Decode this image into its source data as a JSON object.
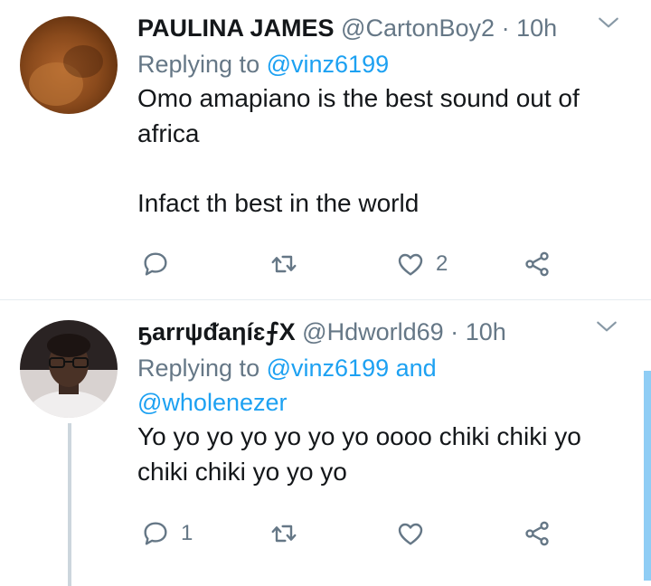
{
  "tweets": [
    {
      "name": "PAULINA JAMES",
      "handle": "@CartonBoy2",
      "separator": "·",
      "time": "10h",
      "replying_prefix": "Replying to",
      "replying_to": [
        "@vinz6199"
      ],
      "replying_joiner": "",
      "text_lines": [
        "Omo amapiano is the best sound out of",
        "africa",
        "",
        "Infact th best in the world"
      ],
      "reply_count": "",
      "retweet_count": "",
      "like_count": "2"
    },
    {
      "name": "ҕarrψᵭaηíɛ⨍X",
      "handle": "@Hdworld69",
      "separator": "·",
      "time": "10h",
      "replying_prefix": "Replying to",
      "replying_to": [
        "@vinz6199",
        "@wholenezer"
      ],
      "replying_joiner": "and",
      "text_lines": [
        "Yo yo yo yo yo yo yo oooo chiki chiki yo",
        "chiki chiki yo yo yo"
      ],
      "reply_count": "1",
      "retweet_count": "",
      "like_count": ""
    }
  ],
  "icons": {
    "reply": "reply-icon",
    "retweet": "retweet-icon",
    "like": "heart-icon",
    "share": "share-icon",
    "more": "chevron-down-icon"
  },
  "colors": {
    "text": "#14171a",
    "secondary": "#657786",
    "link": "#1da1f2",
    "divider": "#e6ecf0"
  }
}
